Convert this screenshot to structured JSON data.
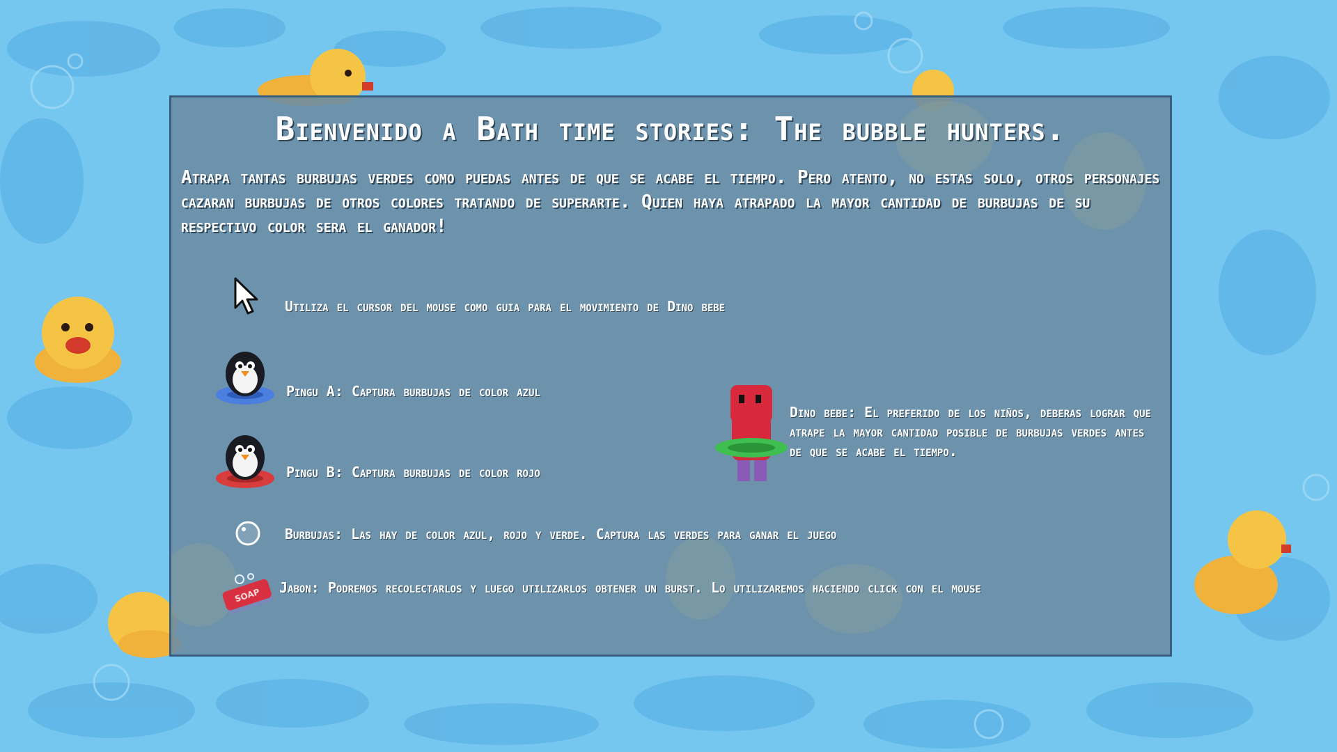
{
  "dialog": {
    "title": "Bienvenido a Bath time stories: The bubble hunters.",
    "intro": "Atrapa tantas burbujas verdes como puedas antes de que se acabe el tiempo. Pero atento, no estas solo, otros personajes cazaran burbujas de otros colores tratando de superarte. Quien haya atrapado la mayor cantidad de burbujas de su respectivo color sera el ganador!"
  },
  "instructions": {
    "cursor": "Utiliza el cursor del mouse como guia para el movimiento de Dino bebe",
    "pingu_a": "Pingu A: Captura burbujas de color azul",
    "pingu_b": "Pingu B: Captura burbujas de color rojo",
    "dino": "Dino bebe: El preferido de los niños, deberas lograr que atrape la mayor cantidad posible de burbujas verdes antes de que se acabe el tiempo.",
    "bubbles": "Burbujas: Las hay de color azul, rojo y verde. Captura las verdes para ganar el juego",
    "soap": "Jabon: Podremos recolectarlos y luego utilizarlos  obtener un burst. Lo utilizaremos haciendo click con el mouse",
    "soap_label": "SOAP"
  },
  "icons": {
    "cursor": "mouse-cursor-icon",
    "pingu_a": "penguin-blue-float-icon",
    "pingu_b": "penguin-red-float-icon",
    "dino": "red-dino-icon",
    "bubble": "bubble-icon",
    "soap": "soap-icon"
  },
  "colors": {
    "water": "#74c6ee",
    "panel": "#6c8ca4",
    "pingu_a_float": "#4a7fe0",
    "pingu_b_float": "#d83c3c",
    "dino": "#d8283c",
    "duck": "#f6c444"
  }
}
